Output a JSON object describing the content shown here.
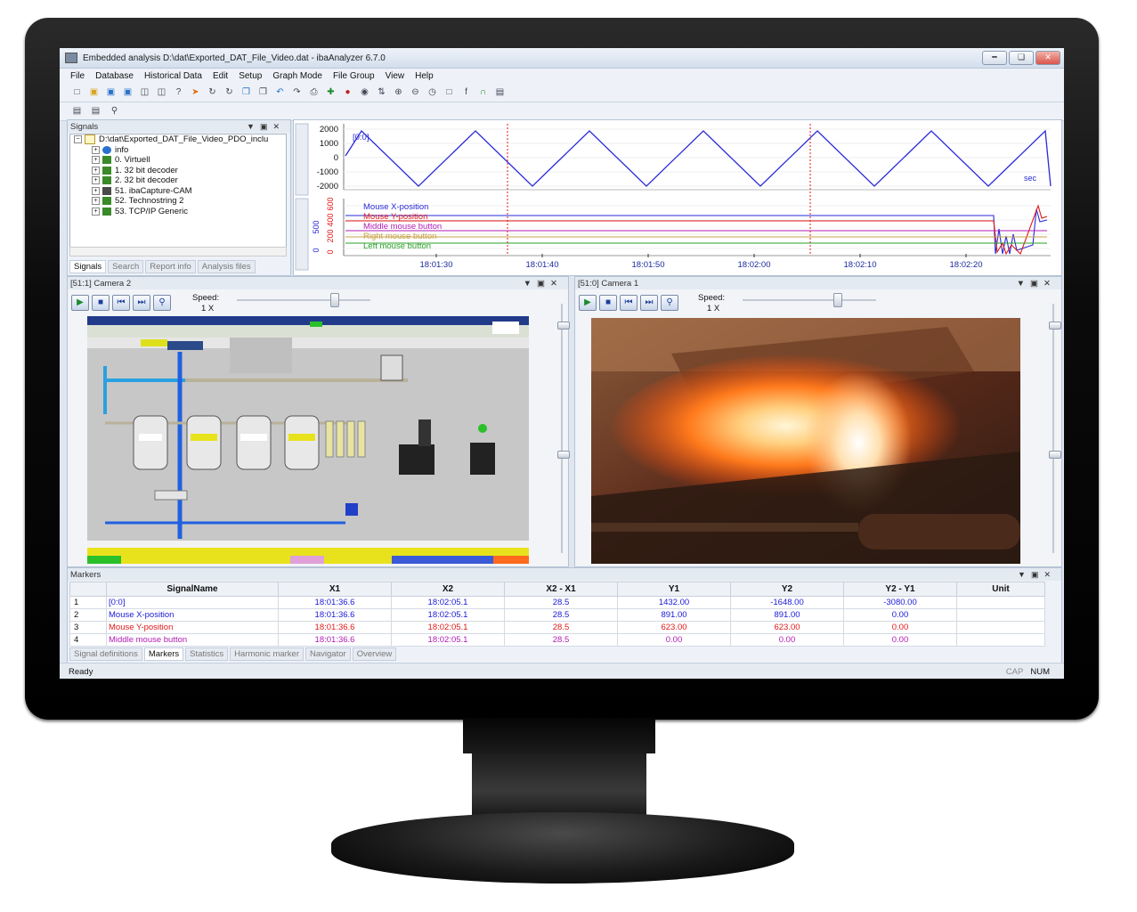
{
  "window": {
    "title": "Embedded analysis  D:\\dat\\Exported_DAT_File_Video.dat - ibaAnalyzer 6.7.0"
  },
  "menu": [
    "File",
    "Database",
    "Historical Data",
    "Edit",
    "Setup",
    "Graph Mode",
    "File Group",
    "View",
    "Help"
  ],
  "signals_panel": {
    "title": "Signals",
    "root": "D:\\dat\\Exported_DAT_File_Video_PDO_inclu",
    "items": [
      "info",
      "0. Virtuell",
      "1. 32 bit decoder",
      "2. 32 bit decoder",
      "51. ibaCapture-CAM",
      "52. Technostring 2",
      "53. TCP/IP Generic"
    ],
    "tabs": [
      "Signals",
      "Search",
      "Report info",
      "Analysis files"
    ]
  },
  "graph": {
    "top": {
      "series": "[0:0]",
      "yticks": [
        "2000",
        "1000",
        "0",
        "-1000",
        "-2000"
      ],
      "unit": "sec"
    },
    "bottom": {
      "series": [
        "Mouse X-position",
        "Mouse Y-position",
        "Middle mouse button",
        "Right mouse button",
        "Left mouse button"
      ],
      "yticks": [
        "600",
        "400",
        "200",
        "0"
      ],
      "left_ticks": [
        "500",
        "0"
      ]
    },
    "xticks": [
      "18:01:30",
      "18:01:40",
      "18:01:50",
      "18:02:00",
      "18:02:10",
      "18:02:20"
    ]
  },
  "camera2": {
    "title": "[51:1] Camera 2",
    "speed_label": "Speed:",
    "speed_value": "1 X"
  },
  "camera1": {
    "title": "[51:0] Camera 1",
    "speed_label": "Speed:",
    "speed_value": "1 X"
  },
  "markers": {
    "title": "Markers",
    "columns": [
      "",
      "SignalName",
      "X1",
      "X2",
      "X2 - X1",
      "Y1",
      "Y2",
      "Y2 - Y1",
      "Unit"
    ],
    "rows": [
      {
        "idx": "1",
        "name": "[0:0]",
        "x1": "18:01:36.6",
        "x2": "18:02:05.1",
        "dx": "28.5",
        "y1": "1432.00",
        "y2": "-1648.00",
        "dy": "-3080.00",
        "unit": ""
      },
      {
        "idx": "2",
        "name": "Mouse X-position",
        "x1": "18:01:36.6",
        "x2": "18:02:05.1",
        "dx": "28.5",
        "y1": "891.00",
        "y2": "891.00",
        "dy": "0.00",
        "unit": ""
      },
      {
        "idx": "3",
        "name": "Mouse Y-position",
        "x1": "18:01:36.6",
        "x2": "18:02:05.1",
        "dx": "28.5",
        "y1": "623.00",
        "y2": "623.00",
        "dy": "0.00",
        "unit": ""
      },
      {
        "idx": "4",
        "name": "Middle mouse button",
        "x1": "18:01:36.6",
        "x2": "18:02:05.1",
        "dx": "28.5",
        "y1": "0.00",
        "y2": "0.00",
        "dy": "0.00",
        "unit": ""
      }
    ],
    "tabs": [
      "Signal definitions",
      "Markers",
      "Statistics",
      "Harmonic marker",
      "Navigator",
      "Overview"
    ]
  },
  "status": {
    "text": "Ready",
    "cap": "CAP",
    "num": "NUM"
  },
  "colors": {
    "blue": "#1a1ad8",
    "red": "#e01818",
    "magenta": "#b21bb4",
    "marker": "#e01818",
    "green": "#2aa02a"
  }
}
